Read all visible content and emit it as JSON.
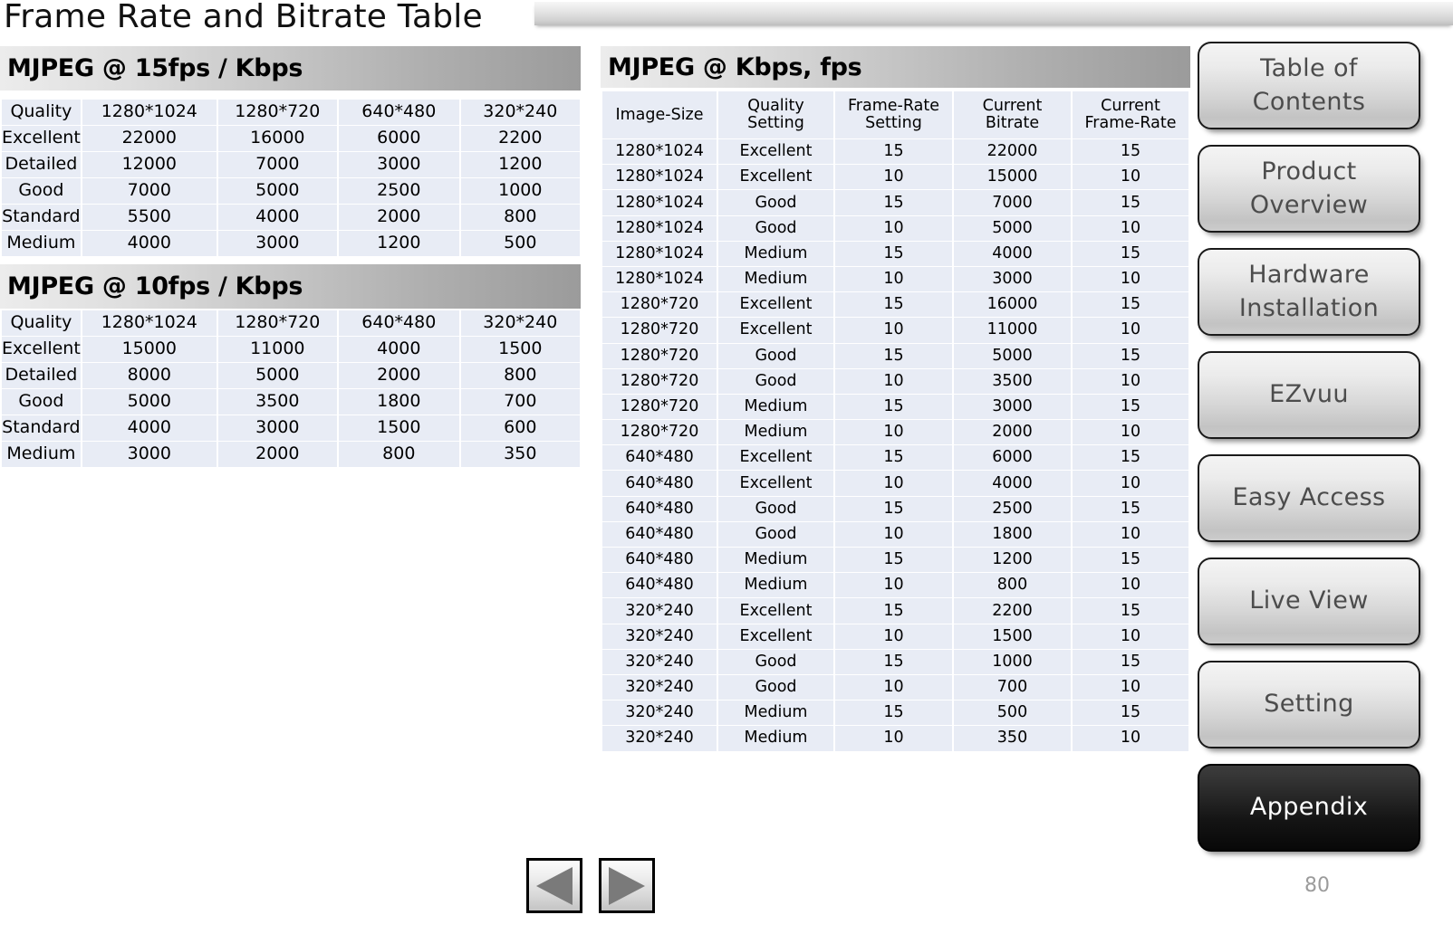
{
  "slide": {
    "title": "Frame Rate and Bitrate Table",
    "page_number": "80"
  },
  "sections": {
    "mjpeg_15fps_banner": "MJPEG @ 15fps / Kbps",
    "mjpeg_10fps_banner": "MJPEG @ 10fps / Kbps",
    "mjpeg_summary_banner": "MJPEG @ Kbps, fps"
  },
  "chart_data": [
    {
      "type": "table",
      "title": "MJPEG @ 15fps / Kbps",
      "columns": [
        "Quality",
        "1280*1024",
        "1280*720",
        "640*480",
        "320*240"
      ],
      "rows": [
        [
          "Excellent",
          "22000",
          "16000",
          "6000",
          "2200"
        ],
        [
          "Detailed",
          "12000",
          "7000",
          "3000",
          "1200"
        ],
        [
          "Good",
          "7000",
          "5000",
          "2500",
          "1000"
        ],
        [
          "Standard",
          "5500",
          "4000",
          "2000",
          "800"
        ],
        [
          "Medium",
          "4000",
          "3000",
          "1200",
          "500"
        ]
      ]
    },
    {
      "type": "table",
      "title": "MJPEG @ 10fps / Kbps",
      "columns": [
        "Quality",
        "1280*1024",
        "1280*720",
        "640*480",
        "320*240"
      ],
      "rows": [
        [
          "Excellent",
          "15000",
          "11000",
          "4000",
          "1500"
        ],
        [
          "Detailed",
          "8000",
          "5000",
          "2000",
          "800"
        ],
        [
          "Good",
          "5000",
          "3500",
          "1800",
          "700"
        ],
        [
          "Standard",
          "4000",
          "3000",
          "1500",
          "600"
        ],
        [
          "Medium",
          "3000",
          "2000",
          "800",
          "350"
        ]
      ]
    },
    {
      "type": "table",
      "title": "MJPEG @ Kbps, fps",
      "columns": [
        "Image-Size",
        "Quality Setting",
        "Frame-Rate Setting",
        "Current Bitrate",
        "Current Frame-Rate"
      ],
      "columns_wrapped": [
        [
          "Image-Size",
          ""
        ],
        [
          "Quality",
          "Setting"
        ],
        [
          "Frame-Rate",
          "Setting"
        ],
        [
          "Current",
          "Bitrate"
        ],
        [
          "Current",
          "Frame-Rate"
        ]
      ],
      "rows": [
        [
          "1280*1024",
          "Excellent",
          "15",
          "22000",
          "15"
        ],
        [
          "1280*1024",
          "Excellent",
          "10",
          "15000",
          "10"
        ],
        [
          "1280*1024",
          "Good",
          "15",
          "7000",
          "15"
        ],
        [
          "1280*1024",
          "Good",
          "10",
          "5000",
          "10"
        ],
        [
          "1280*1024",
          "Medium",
          "15",
          "4000",
          "15"
        ],
        [
          "1280*1024",
          "Medium",
          "10",
          "3000",
          "10"
        ],
        [
          "1280*720",
          "Excellent",
          "15",
          "16000",
          "15"
        ],
        [
          "1280*720",
          "Excellent",
          "10",
          "11000",
          "10"
        ],
        [
          "1280*720",
          "Good",
          "15",
          "5000",
          "15"
        ],
        [
          "1280*720",
          "Good",
          "10",
          "3500",
          "10"
        ],
        [
          "1280*720",
          "Medium",
          "15",
          "3000",
          "15"
        ],
        [
          "1280*720",
          "Medium",
          "10",
          "2000",
          "10"
        ],
        [
          "640*480",
          "Excellent",
          "15",
          "6000",
          "15"
        ],
        [
          "640*480",
          "Excellent",
          "10",
          "4000",
          "10"
        ],
        [
          "640*480",
          "Good",
          "15",
          "2500",
          "15"
        ],
        [
          "640*480",
          "Good",
          "10",
          "1800",
          "10"
        ],
        [
          "640*480",
          "Medium",
          "15",
          "1200",
          "15"
        ],
        [
          "640*480",
          "Medium",
          "10",
          "800",
          "10"
        ],
        [
          "320*240",
          "Excellent",
          "15",
          "2200",
          "15"
        ],
        [
          "320*240",
          "Excellent",
          "10",
          "1500",
          "10"
        ],
        [
          "320*240",
          "Good",
          "15",
          "1000",
          "15"
        ],
        [
          "320*240",
          "Good",
          "10",
          "700",
          "10"
        ],
        [
          "320*240",
          "Medium",
          "15",
          "500",
          "15"
        ],
        [
          "320*240",
          "Medium",
          "10",
          "350",
          "10"
        ]
      ]
    }
  ],
  "side_nav": {
    "items": [
      {
        "label": "Table of\nContents",
        "active": false
      },
      {
        "label": "Product\nOverview",
        "active": false
      },
      {
        "label": "Hardware\nInstallation",
        "active": false
      },
      {
        "label": "EZvuu",
        "active": false
      },
      {
        "label": "Easy Access",
        "active": false
      },
      {
        "label": "Live View",
        "active": false
      },
      {
        "label": "Setting",
        "active": false
      },
      {
        "label": "Appendix",
        "active": true
      }
    ]
  },
  "pager": {
    "prev_icon": "triangle-left-icon",
    "next_icon": "triangle-right-icon"
  },
  "colors": {
    "cell_background": "#e8ecf5",
    "banner_start": "#ececec",
    "banner_end": "#9b9b9b",
    "active_nav_background": "#141414",
    "nav_label": "#4c4c4c",
    "page_number": "#9b9b9b"
  }
}
